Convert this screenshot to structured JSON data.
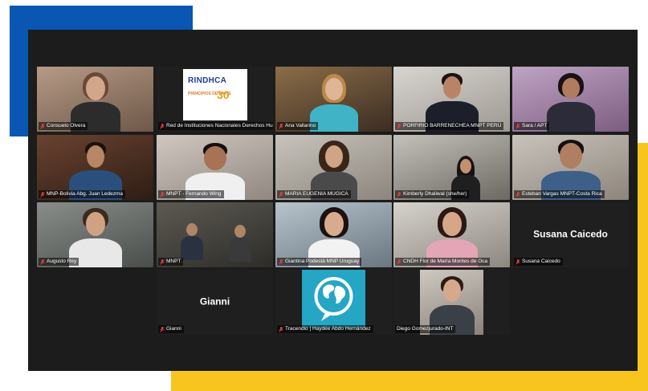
{
  "brand_colors": {
    "blue": "#0a56b3",
    "yellow": "#f7c51e",
    "window": "#1c1c1c",
    "active_speaker": "#c4d65a"
  },
  "logo": {
    "title": "RINDHCA",
    "subtitle": "PRINCIPIOS DE PARÍS",
    "anniversary": "30"
  },
  "participants": [
    {
      "name": "Consuelo Olvera",
      "icon": "muted-mic-icon",
      "active": true
    },
    {
      "name": "Red de Instituciones Nacionales Derechos Hu...",
      "icon": "muted-mic-icon"
    },
    {
      "name": "Ana Vallarino",
      "icon": "muted-mic-icon"
    },
    {
      "name": "PORFIRIO BARRENECHEA MNPT PERÚ",
      "icon": "muted-mic-icon"
    },
    {
      "name": "Sara / APT",
      "icon": "muted-mic-icon"
    },
    {
      "name": "MNP-Bolivia Abg. Juan Ledezma",
      "icon": "muted-mic-icon"
    },
    {
      "name": "MNPT - Fernando Wing",
      "icon": "muted-mic-icon"
    },
    {
      "name": "MARIA EUGENIA MUGICA",
      "icon": "muted-mic-icon"
    },
    {
      "name": "Kimberly Dhaliwal (she/her)",
      "icon": "muted-mic-icon"
    },
    {
      "name": "Esteban Vargas MNPT-Costa Rica",
      "icon": "muted-mic-icon"
    },
    {
      "name": "Augusto Rey",
      "icon": "muted-mic-icon"
    },
    {
      "name": "MNPT",
      "icon": "muted-mic-icon"
    },
    {
      "name": "Giantina Podestá MNP Uruguay",
      "icon": "muted-mic-icon"
    },
    {
      "name": "CNDH Flor de María Montes de Oca",
      "icon": "muted-mic-icon"
    },
    {
      "name": "Susana Caicedo",
      "icon": "muted-mic-icon",
      "display_name": "Susana Caicedo"
    },
    {
      "name": "Gianni",
      "icon": "muted-mic-icon",
      "display_name": "Gianni"
    },
    {
      "name": "Tracendio | Haydée Abdo Hernández",
      "icon": "muted-mic-icon"
    },
    {
      "name": "Diego Gomezjurado-INT",
      "icon": "none"
    }
  ]
}
